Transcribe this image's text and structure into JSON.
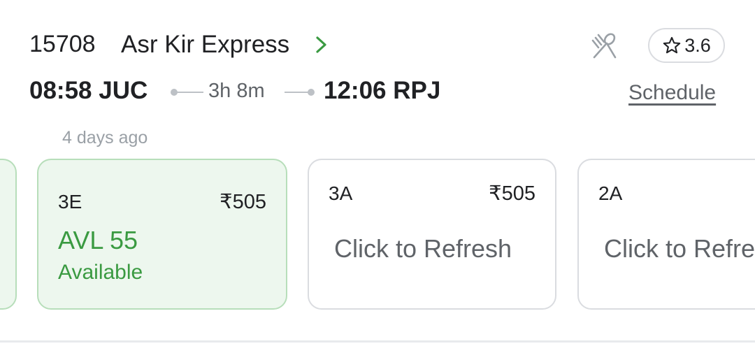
{
  "train": {
    "number": "15708",
    "name": "Asr Kir Express",
    "rating": "3.6",
    "departure": "08:58 JUC",
    "duration": "3h 8m",
    "arrival": "12:06 RPJ",
    "schedule_label": "Schedule",
    "updated": "4 days ago"
  },
  "classes": [
    {
      "class": "3E",
      "price": "₹505",
      "status": "AVL 55",
      "status_text": "Available"
    },
    {
      "class": "3A",
      "price": "₹505",
      "action": "Click to Refresh"
    },
    {
      "class": "2A",
      "action": "Click to Refresh"
    }
  ],
  "colors": {
    "available_green": "#3a9a41",
    "available_bg": "#edf7ee",
    "chevron_green": "#3a9a41",
    "muted_text": "#5f6368"
  },
  "icons": [
    "chevron-right-icon",
    "meal-icon",
    "star-icon"
  ]
}
